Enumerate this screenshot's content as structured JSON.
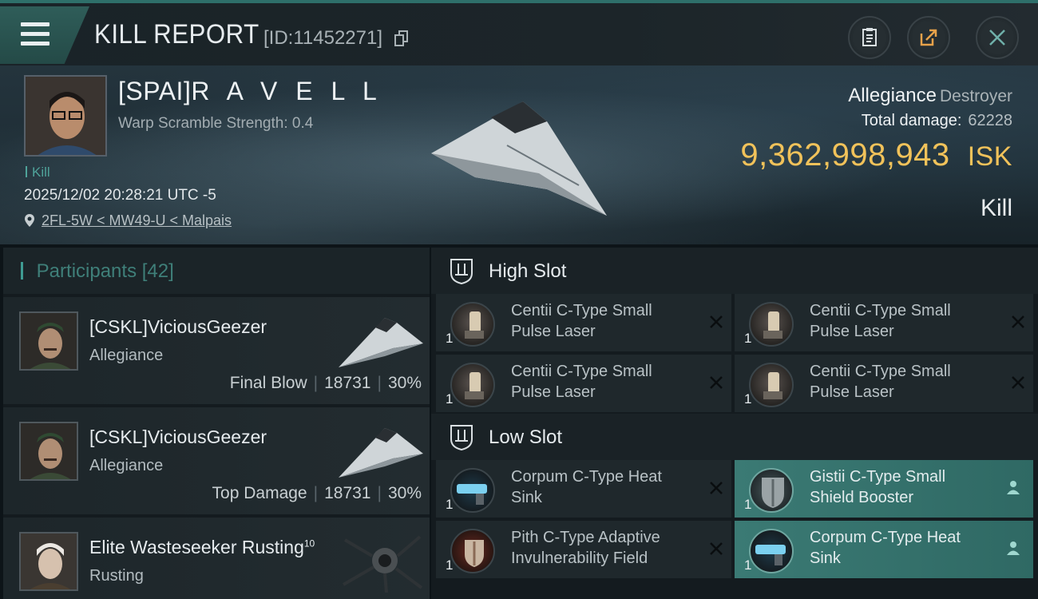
{
  "header": {
    "title": "KILL REPORT",
    "report_id": "[ID:11452271]"
  },
  "victim": {
    "name_prefix": "[SPAI]",
    "name_rest": "R A V E L L",
    "warp_scramble": "Warp Scramble Strength: 0.4",
    "kill_tag": "Kill",
    "timestamp": "2025/12/02 20:28:21 UTC -5",
    "location": "2FL-5W < MW49-U < Malpais",
    "alliance": "Allegiance",
    "ship_class": "Destroyer",
    "total_damage_label": "Total damage:",
    "total_damage": "62228",
    "isk_value": "9,362,998,943",
    "isk_unit": "ISK",
    "result": "Kill"
  },
  "participants": {
    "title": "Participants",
    "count": "[42]",
    "items": [
      {
        "name": "[CSKL]ViciousGeezer",
        "corp": "Allegiance",
        "role": "Final Blow",
        "damage": "18731",
        "percent": "30%"
      },
      {
        "name": "[CSKL]ViciousGeezer",
        "corp": "Allegiance",
        "role": "Top Damage",
        "damage": "18731",
        "percent": "30%"
      },
      {
        "name": "Elite Wasteseeker Rusting",
        "level": "10",
        "corp": "Rusting"
      }
    ]
  },
  "fitting": {
    "high_slot": {
      "label": "High Slot",
      "modules": [
        {
          "name": "Centii C-Type Small Pulse Laser",
          "qty": "1"
        },
        {
          "name": "Centii C-Type Small Pulse Laser",
          "qty": "1"
        },
        {
          "name": "Centii C-Type Small Pulse Laser",
          "qty": "1"
        },
        {
          "name": "Centii C-Type Small Pulse Laser",
          "qty": "1"
        }
      ]
    },
    "low_slot": {
      "label": "Low Slot",
      "modules": [
        {
          "name": "Corpum C-Type Heat Sink",
          "qty": "1"
        },
        {
          "name": "Gistii C-Type Small Shield Booster",
          "qty": "1"
        },
        {
          "name": "Pith C-Type Adaptive Invulnerability Field",
          "qty": "1"
        },
        {
          "name": "Corpum C-Type Heat Sink",
          "qty": "1"
        }
      ]
    }
  },
  "colors": {
    "accent_teal": "#3f9b92",
    "isk_gold": "#f1c25a",
    "active_module": "#3b7a74"
  },
  "icons": [
    "menu-icon",
    "copy-icon",
    "clipboard-icon",
    "share-icon",
    "close-icon",
    "pin-icon",
    "shield-slot-icon",
    "remove-x-icon",
    "person-icon"
  ]
}
